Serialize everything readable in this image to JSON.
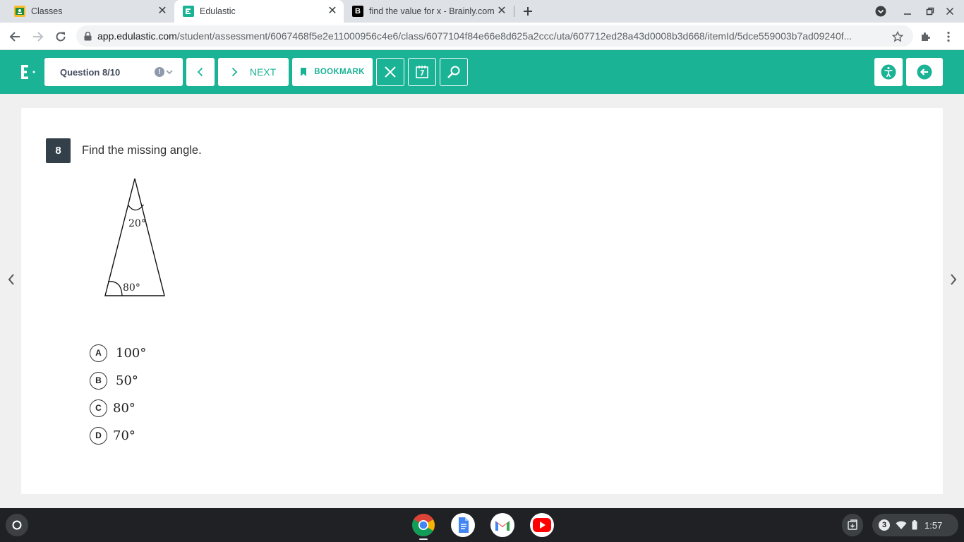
{
  "browser": {
    "tabs": [
      {
        "title": "Classes",
        "favicon": "google-classroom-icon",
        "active": false
      },
      {
        "title": "Edulastic",
        "favicon": "edulastic-icon",
        "active": true
      },
      {
        "title": "find the value for x - Brainly.com",
        "favicon": "brainly-icon",
        "active": false
      }
    ],
    "url_host": "app.edulastic.com",
    "url_path": "/student/assessment/6067468f5e2e11000956c4e6/class/6077104f84e66e8d625a2ccc/uta/607712ed28a43d0008b3d668/itemId/5dce559003b7ad09240f..."
  },
  "header": {
    "question_selector": "Question 8/10",
    "next_label": "NEXT",
    "bookmark_label": "BOOKMARK",
    "brand_color": "#1ab395"
  },
  "question": {
    "number": "8",
    "prompt": "Find the missing angle.",
    "figure": {
      "top_angle_label": "20°",
      "bottom_angle_label": "80°"
    },
    "choices": [
      {
        "letter": "A",
        "text": "100°"
      },
      {
        "letter": "B",
        "text": "50°"
      },
      {
        "letter": "C",
        "text": "80°"
      },
      {
        "letter": "D",
        "text": "70°"
      }
    ]
  },
  "shelf": {
    "apps": [
      "chrome-icon",
      "google-docs-icon",
      "gmail-icon",
      "youtube-icon"
    ],
    "notification_count": "3",
    "time": "1:57"
  }
}
